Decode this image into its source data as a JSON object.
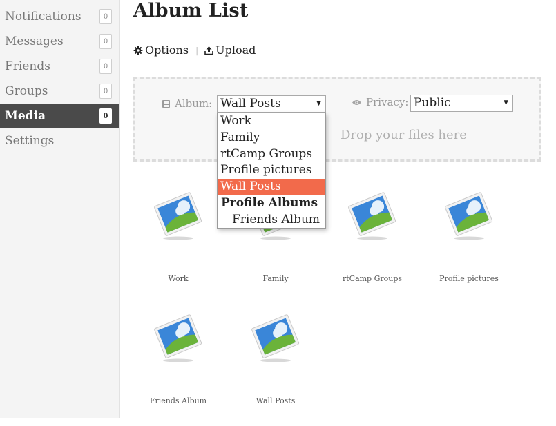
{
  "sidebar": {
    "items": [
      {
        "label": "Notifications",
        "count": "0",
        "active": false
      },
      {
        "label": "Messages",
        "count": "0",
        "active": false
      },
      {
        "label": "Friends",
        "count": "0",
        "active": false
      },
      {
        "label": "Groups",
        "count": "0",
        "active": false
      },
      {
        "label": "Media",
        "count": "0",
        "active": true
      },
      {
        "label": "Settings",
        "count": null,
        "active": false
      }
    ]
  },
  "header": {
    "title": "Album List"
  },
  "actions": {
    "options_label": "Options",
    "upload_label": "Upload"
  },
  "upload": {
    "album_label": "Album:",
    "album_selected": "Wall Posts",
    "privacy_label": "Privacy:",
    "privacy_selected": "Public",
    "drop_text": "Drop your files here"
  },
  "album_dropdown": {
    "options": [
      "Work",
      "Family",
      "rtCamp Groups",
      "Profile pictures",
      "Wall Posts"
    ],
    "group_label": "Profile Albums",
    "group_options": [
      "Friends Album"
    ],
    "selected": "Wall Posts"
  },
  "albums": [
    {
      "name": "Work"
    },
    {
      "name": "Family"
    },
    {
      "name": "rtCamp Groups"
    },
    {
      "name": "Profile pictures"
    },
    {
      "name": "Friends Album"
    },
    {
      "name": "Wall Posts"
    }
  ],
  "colors": {
    "sidebar_active_bg": "#4a4a4a",
    "selected_option_bg": "#f26a4b"
  },
  "icons": {
    "options": "gear-icon",
    "upload": "upload-icon",
    "album": "album-icon",
    "privacy": "eye-icon",
    "thumbnail": "image-placeholder-icon"
  }
}
